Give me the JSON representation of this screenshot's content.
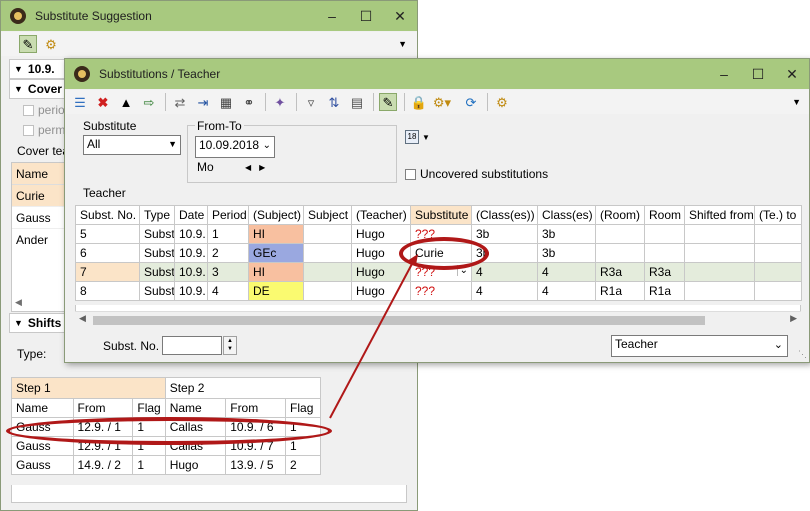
{
  "back": {
    "title": "Substitute Suggestion",
    "date_section": "10.9.",
    "cover_section": "Cover",
    "periods_label": "period",
    "perma_label": "perma",
    "cover_teacher_label": "Cover tea",
    "names_header": "Name",
    "names": [
      "Curie",
      "Gauss",
      "Ander"
    ],
    "shifts_section": "Shifts",
    "type_label": "Type:",
    "steps": {
      "step1": "Step 1",
      "step2": "Step 2",
      "cols": [
        "Name",
        "From",
        "Flag",
        "Name",
        "From",
        "Flag"
      ],
      "rows": [
        [
          "Gauss",
          "12.9. / 1",
          "1",
          "Callas",
          "10.9. / 6",
          "1"
        ],
        [
          "Gauss",
          "12.9. / 1",
          "1",
          "Callas",
          "10.9. / 7",
          "1"
        ],
        [
          "Gauss",
          "14.9. / 2",
          "1",
          "Hugo",
          "13.9. / 5",
          "2"
        ]
      ]
    }
  },
  "front": {
    "title": "Substitutions / Teacher",
    "substitute_label": "Substitute",
    "substitute_value": "All",
    "from_to_label": "From-To",
    "date_value": "10.09.2018",
    "day_label": "Mo",
    "uncovered_label": "Uncovered substitutions",
    "teacher_label": "Teacher",
    "columns": [
      "Subst. No.",
      "Type",
      "Date",
      "Period",
      "(Subject)",
      "Subject",
      "(Teacher)",
      "Substitute",
      "(Class(es))",
      "Class(es)",
      "(Room)",
      "Room",
      "Shifted from",
      "(Te.) to"
    ],
    "rows": [
      [
        "5",
        "Substi",
        "10.9.",
        "1",
        "HI",
        "",
        "Hugo",
        "???",
        "3b",
        "3b",
        "",
        "",
        "",
        ""
      ],
      [
        "6",
        "Substi",
        "10.9.",
        "2",
        "GEc",
        "",
        "Hugo",
        "Curie",
        "3b",
        "3b",
        "",
        "",
        "",
        ""
      ],
      [
        "7",
        "Substi",
        "10.9.",
        "3",
        "HI",
        "",
        "Hugo",
        "???",
        "4",
        "4",
        "R3a",
        "R3a",
        "",
        ""
      ],
      [
        "8",
        "Substi",
        "10.9.",
        "4",
        "DE",
        "",
        "Hugo",
        "???",
        "4",
        "4",
        "R1a",
        "R1a",
        "",
        ""
      ]
    ],
    "subject_colors": [
      "#f8c0a0",
      "#9aa8e0",
      "#f8c0a0",
      "#fafa70"
    ],
    "subst_no_label": "Subst. No.",
    "view_select": "Teacher"
  },
  "colors": {
    "title_bar": "#a8c97f",
    "highlight_row": "#e4ecdc",
    "annotation": "#b01818"
  }
}
